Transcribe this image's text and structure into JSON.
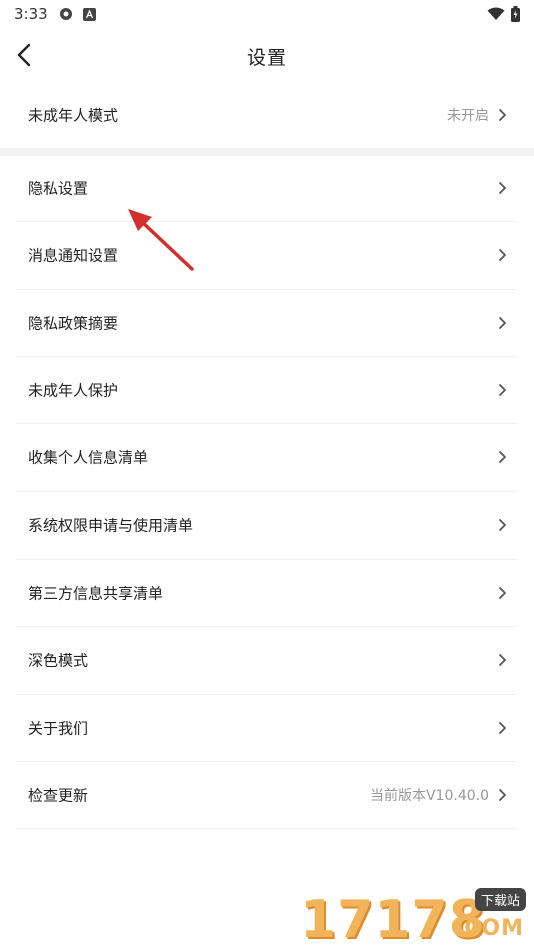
{
  "status_bar": {
    "time": "3:33",
    "icons": [
      "gear-status-icon",
      "a-badge-icon",
      "wifi-icon",
      "battery-icon"
    ]
  },
  "header": {
    "title": "设置",
    "back_icon": "chevron-left-icon"
  },
  "rows": [
    {
      "label": "未成年人模式",
      "value": "未开启"
    },
    {
      "label": "隐私设置",
      "value": ""
    },
    {
      "label": "消息通知设置",
      "value": ""
    },
    {
      "label": "隐私政策摘要",
      "value": ""
    },
    {
      "label": "未成年人保护",
      "value": ""
    },
    {
      "label": "收集个人信息清单",
      "value": ""
    },
    {
      "label": "系统权限申请与使用清单",
      "value": ""
    },
    {
      "label": "第三方信息共享清单",
      "value": ""
    },
    {
      "label": "深色模式",
      "value": ""
    },
    {
      "label": "关于我们",
      "value": ""
    },
    {
      "label": "检查更新",
      "value": "当前版本V10.40.0"
    }
  ],
  "watermark": {
    "digits": "17178",
    "badge": "下载站",
    "domain": ".COM"
  },
  "colors": {
    "annotation_arrow": "#d32f2f",
    "chevron": "#555555",
    "value_text": "#999999",
    "watermark_orange": "#f2b45a"
  }
}
